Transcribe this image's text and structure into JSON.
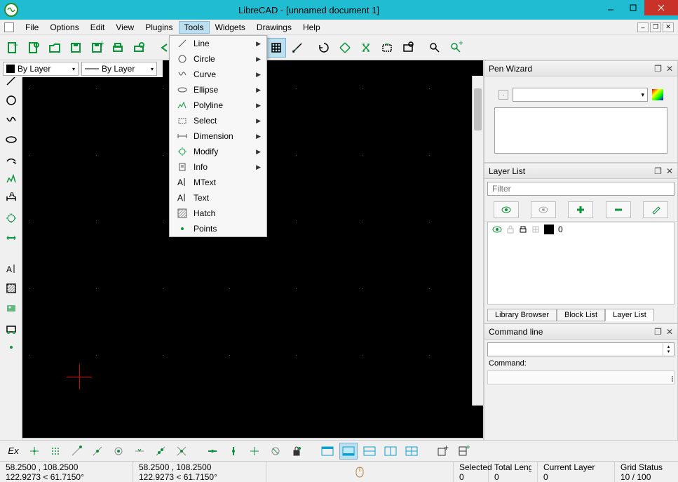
{
  "title": "LibreCAD - [unnamed document 1]",
  "menubar": [
    "File",
    "Options",
    "Edit",
    "View",
    "Plugins",
    "Tools",
    "Widgets",
    "Drawings",
    "Help"
  ],
  "active_menu_index": 5,
  "tools_menu": [
    {
      "label": "Line",
      "sub": true,
      "icon": "line"
    },
    {
      "label": "Circle",
      "sub": true,
      "icon": "circle"
    },
    {
      "label": "Curve",
      "sub": true,
      "icon": "curve"
    },
    {
      "label": "Ellipse",
      "sub": true,
      "icon": "ellipse"
    },
    {
      "label": "Polyline",
      "sub": true,
      "icon": "polyline"
    },
    {
      "label": "Select",
      "sub": true,
      "icon": "select"
    },
    {
      "label": "Dimension",
      "sub": true,
      "icon": "dimension"
    },
    {
      "label": "Modify",
      "sub": true,
      "icon": "modify"
    },
    {
      "label": "Info",
      "sub": true,
      "icon": "info"
    },
    {
      "label": "MText",
      "sub": false,
      "icon": "mtext"
    },
    {
      "label": "Text",
      "sub": false,
      "icon": "text"
    },
    {
      "label": "Hatch",
      "sub": false,
      "icon": "hatch"
    },
    {
      "label": "Points",
      "sub": false,
      "icon": "points"
    }
  ],
  "color_combo": "By Layer",
  "line_combo": "By Layer",
  "panels": {
    "pen_wizard": {
      "title": "Pen Wizard"
    },
    "layer_list": {
      "title": "Layer List",
      "filter_placeholder": "Filter",
      "layers": [
        {
          "name": "0"
        }
      ],
      "tabs": [
        "Library Browser",
        "Block List",
        "Layer List"
      ],
      "active_tab": 2
    },
    "command_line": {
      "title": "Command line",
      "label": "Command:"
    }
  },
  "status": {
    "coord1_line1": "58.2500 , 108.2500",
    "coord1_line2": "122.9273 < 61.7150°",
    "coord2_line1": "58.2500 , 108.2500",
    "coord2_line2": "122.9273 < 61.7150°",
    "selected_label": "Selected",
    "selected_val": "0",
    "total_len_label": "Total Length",
    "total_len_val": "0",
    "current_layer_label": "Current Layer",
    "current_layer_val": "0",
    "grid_label": "Grid Status",
    "grid_val": "10 / 100"
  },
  "bottom_ex": "Ex"
}
